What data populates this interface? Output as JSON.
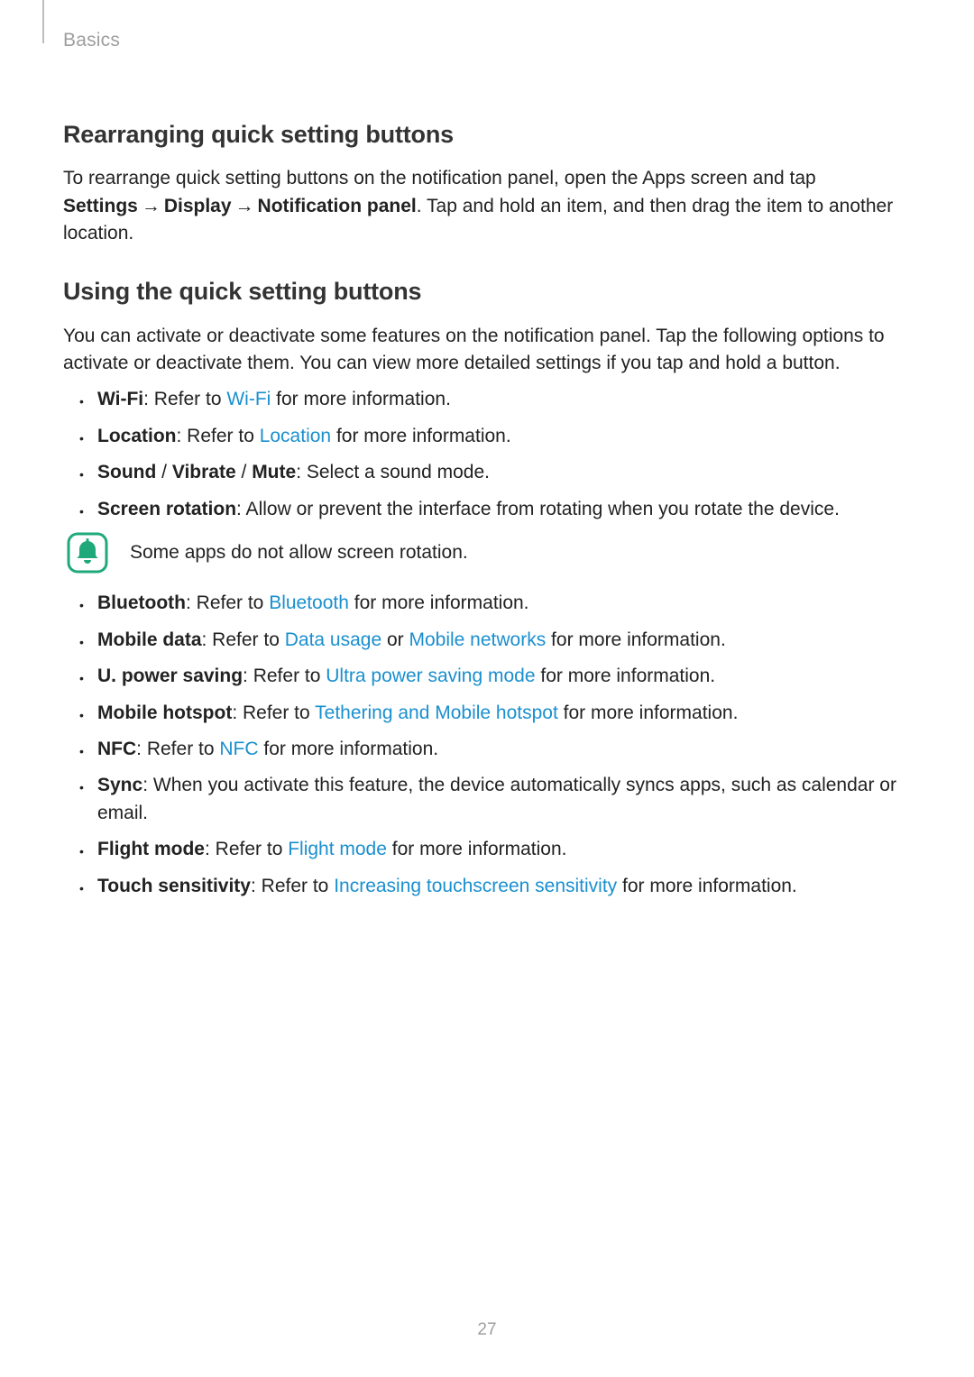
{
  "header": {
    "chapter": "Basics"
  },
  "section1": {
    "heading": "Rearranging quick setting buttons",
    "intro_pre": "To rearrange quick setting buttons on the notification panel, open the Apps screen and tap ",
    "path_settings": "Settings",
    "path_display": "Display",
    "path_panel": "Notification panel",
    "intro_post": ". Tap and hold an item, and then drag the item to another location.",
    "arrow": "→"
  },
  "section2": {
    "heading": "Using the quick setting buttons",
    "intro": "You can activate or deactivate some features on the notification panel. Tap the following options to activate or deactivate them. You can view more detailed settings if you tap and hold a button.",
    "note_text": "Some apps do not allow screen rotation.",
    "items": {
      "wifi": {
        "label": "Wi-Fi",
        "pre": ": Refer to ",
        "link": "Wi-Fi",
        "post": " for more information."
      },
      "location": {
        "label": "Location",
        "pre": ": Refer to ",
        "link": "Location",
        "post": " for more information."
      },
      "sound": {
        "label_sound": "Sound",
        "label_vibrate": "Vibrate",
        "label_mute": "Mute",
        "post": ": Select a sound mode."
      },
      "rotation": {
        "label": "Screen rotation",
        "post": ": Allow or prevent the interface from rotating when you rotate the device."
      },
      "bluetooth": {
        "label": "Bluetooth",
        "pre": ": Refer to ",
        "link": "Bluetooth",
        "post": " for more information."
      },
      "mobiledata": {
        "label": "Mobile data",
        "pre": ": Refer to ",
        "link1": "Data usage",
        "mid": " or ",
        "link2": "Mobile networks",
        "post": " for more information."
      },
      "upower": {
        "label": "U. power saving",
        "pre": ": Refer to ",
        "link": "Ultra power saving mode",
        "post": " for more information."
      },
      "hotspot": {
        "label": "Mobile hotspot",
        "pre": ": Refer to ",
        "link": "Tethering and Mobile hotspot",
        "post": " for more information."
      },
      "nfc": {
        "label": "NFC",
        "pre": ": Refer to ",
        "link": "NFC",
        "post": " for more information."
      },
      "sync": {
        "label": "Sync",
        "post": ": When you activate this feature, the device automatically syncs apps, such as calendar or email."
      },
      "flight": {
        "label": "Flight mode",
        "pre": ": Refer to ",
        "link": "Flight mode",
        "post": " for more information."
      },
      "touch": {
        "label": "Touch sensitivity",
        "pre": ": Refer to ",
        "link": "Increasing touchscreen sensitivity",
        "post": " for more information."
      }
    }
  },
  "page_number": "27"
}
